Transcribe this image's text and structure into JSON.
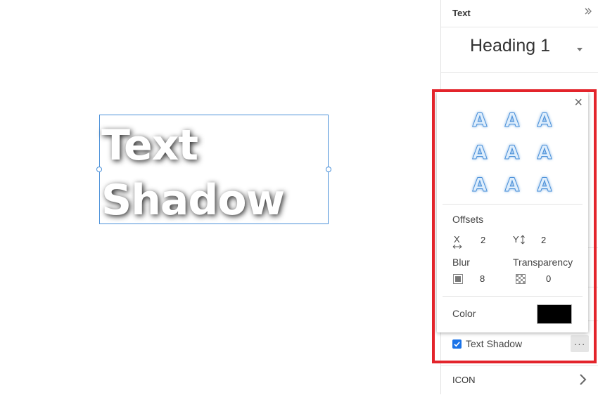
{
  "canvas": {
    "text_lines": [
      "Text",
      "Shadow"
    ]
  },
  "panel": {
    "title": "Text",
    "style_value": "Heading 1",
    "checkbox_label": "Text Shadow",
    "more_label": "···",
    "icon_row_label": "ICON"
  },
  "popup": {
    "close_label": "×",
    "preset_glyph": "A",
    "offsets_label": "Offsets",
    "x_label": "X",
    "x_value": "2",
    "y_label": "Y",
    "y_value": "2",
    "blur_label": "Blur",
    "blur_value": "8",
    "transparency_label": "Transparency",
    "transparency_value": "0",
    "color_label": "Color",
    "color_value": "#000000"
  },
  "colors": {
    "accent": "#1a73e8",
    "selection": "#4a90d9",
    "highlight": "#e3242b"
  }
}
